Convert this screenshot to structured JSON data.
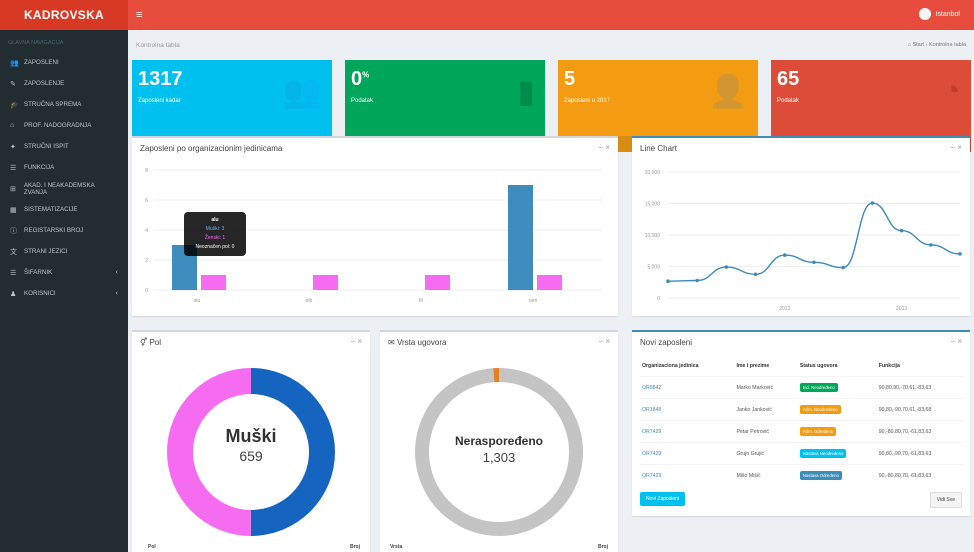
{
  "header": {
    "brand": "KADROVSKA",
    "toggle": "≡",
    "user": "Istanbol"
  },
  "sidebar": {
    "section": "GLAVNA NAVIGACIJA",
    "items": [
      {
        "label": "ZAPOSLENI",
        "icon": "users-icon",
        "glyph": "👥"
      },
      {
        "label": "ZAPOSLENJE",
        "icon": "edit-icon",
        "glyph": "✎"
      },
      {
        "label": "STRUČNA SPREMA",
        "icon": "graduation-icon",
        "glyph": "🎓"
      },
      {
        "label": "PROF. NADOGRADNJA",
        "icon": "building-icon",
        "glyph": "⌂"
      },
      {
        "label": "STRUČNI ISPIT",
        "icon": "certificate-icon",
        "glyph": "✦"
      },
      {
        "label": "FUNKCIJA",
        "icon": "list-icon",
        "glyph": "☰"
      },
      {
        "label": "AKAD. I NEAKADEMSKA ZVANJA",
        "icon": "bank-icon",
        "glyph": "⊞"
      },
      {
        "label": "SISTEMATIZACIJE",
        "icon": "table-icon",
        "glyph": "▦"
      },
      {
        "label": "REGISTARSKI BROJ",
        "icon": "info-icon",
        "glyph": "ⓘ"
      },
      {
        "label": "STRANI JEZICI",
        "icon": "language-icon",
        "glyph": "文"
      },
      {
        "label": "ŠIFARNIK",
        "icon": "menu-icon",
        "glyph": "☰",
        "chevron": "‹"
      },
      {
        "label": "KORISNICI",
        "icon": "user-icon",
        "glyph": "♟",
        "chevron": "‹"
      }
    ]
  },
  "page": {
    "title": "Kontrolna tabla",
    "breadcrumb_home": "Start",
    "breadcrumb_current": "Kontrolna tabla"
  },
  "boxes": [
    {
      "value": "1317",
      "sup": "",
      "label": "Zaposleni kadar",
      "footer": "Više informacija",
      "color": "#00c0ef",
      "icon": "users-icon"
    },
    {
      "value": "0",
      "sup": "%",
      "label": "Podatak",
      "footer": "Više informacija",
      "color": "#00a65a",
      "icon": "bar-chart-icon"
    },
    {
      "value": "5",
      "sup": "",
      "label": "Zaposleni u 2017",
      "footer": "Više informacija",
      "color": "#f39c12",
      "icon": "user-plus-icon"
    },
    {
      "value": "65",
      "sup": "",
      "label": "Podatak",
      "footer": "Više informacija",
      "color": "#dd4b39",
      "icon": "pie-chart-icon"
    }
  ],
  "panels": {
    "org": {
      "title": "Zaposleni po organizacionim jedinicama",
      "tools": "−  ×"
    },
    "line": {
      "title": "Line Chart",
      "tools": "−  ×"
    },
    "pol": {
      "title": "Pol",
      "tools": "−  ×",
      "center_label": "Muški",
      "center_value": "659",
      "foot_left": "Pol",
      "foot_right": "Broj"
    },
    "ugovor": {
      "title": "Vrsta ugovora",
      "tools": "−  ×",
      "center_label": "Neraspoređeno",
      "center_value": "1,303",
      "foot_left": "Vrsta",
      "foot_right": "Broj"
    },
    "novi": {
      "title": "Novi zaposleni",
      "tools": "−  ×",
      "btn_new": "Novi Zaposleni",
      "btn_all": "Vidi Sve"
    }
  },
  "tooltip": {
    "title": "alu",
    "line1": "Muški: 3",
    "line2": "Ženski: 1",
    "line3": "Neoznačen pol: 0"
  },
  "employees": {
    "headers": [
      "Organizaciona jedinica",
      "Ime i prezime",
      "Status ugovora",
      "Funkcija"
    ],
    "rows": [
      {
        "org": "OR9842",
        "name": "Marko Marković",
        "status": "Ind. Neodređeno",
        "status_color": "#00a65a",
        "func": "90,80,90,-70,61,-83,63"
      },
      {
        "org": "OR1848",
        "name": "Janko Janković",
        "status": "Adm. Neodređeno",
        "status_color": "#f39c12",
        "func": "90,80,-90,70,61,-83,68"
      },
      {
        "org": "OR7429",
        "name": "Petar Petrović",
        "status": "Adm. Određeno",
        "status_color": "#f39c12",
        "func": "90,-80,80,70,-61,83,63"
      },
      {
        "org": "OR7429",
        "name": "Grujo Grujić",
        "status": "Nastava Neodređeno",
        "status_color": "#00c0ef",
        "func": "90,80,-90,70,-61,83,63"
      },
      {
        "org": "OR7429",
        "name": "Mišo Mišić",
        "status": "Nastava Određeno",
        "status_color": "#3c8dbc",
        "func": "90,-80,80,70,-61,83,63"
      }
    ]
  },
  "chart_data": [
    {
      "type": "bar",
      "categories": [
        "alu",
        "elb",
        "fit",
        "ram"
      ],
      "series": [
        {
          "name": "Muški",
          "values": [
            3,
            0,
            0,
            7
          ],
          "color": "#3c8dbc"
        },
        {
          "name": "Ženski",
          "values": [
            1,
            1,
            1,
            1
          ],
          "color": "#f56cf0"
        },
        {
          "name": "Neoznačen pol",
          "values": [
            0,
            0,
            0,
            0
          ],
          "color": "#999999"
        }
      ],
      "yticks": [
        0,
        2,
        4,
        6,
        8
      ],
      "ylim": [
        0,
        8
      ]
    },
    {
      "type": "line",
      "x": [
        2011.0,
        2011.25,
        2011.5,
        2011.75,
        2012.0,
        2012.25,
        2012.5,
        2012.75,
        2013.0,
        2013.25,
        2013.5
      ],
      "values": [
        2666,
        2778,
        4912,
        3767,
        6810,
        5670,
        4820,
        15073,
        10687,
        8432,
        7000
      ],
      "xticks": [
        "2012",
        "2013"
      ],
      "yticks": [
        "0",
        "5,000",
        "10,000",
        "15,000",
        "20,000"
      ],
      "ylim": [
        0,
        20000
      ],
      "color": "#3c8dbc"
    },
    {
      "type": "pie",
      "labels": [
        "Muški",
        "Ženski"
      ],
      "values": [
        659,
        658
      ],
      "colors": [
        "#1565c0",
        "#f56cf0"
      ]
    },
    {
      "type": "pie",
      "labels": [
        "Neraspoređeno",
        "Ostalo"
      ],
      "values": [
        1303,
        14
      ],
      "colors": [
        "#c4c4c4",
        "#e67e22"
      ]
    }
  ]
}
